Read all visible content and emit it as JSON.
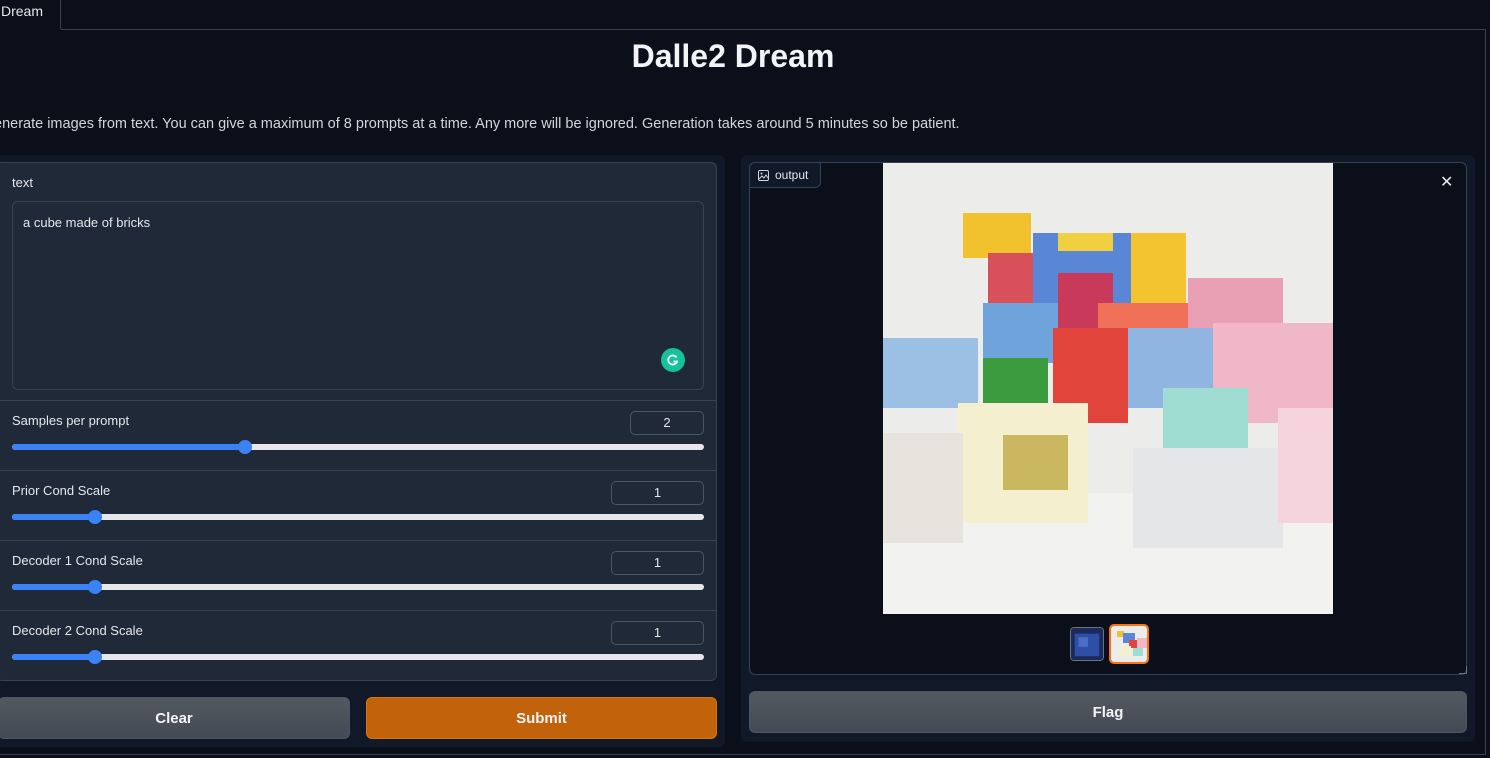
{
  "tab": {
    "label": "Dream"
  },
  "header": {
    "title": "Dalle2 Dream",
    "description": "enerate images from text. You can give a maximum of 8 prompts at a time. Any more will be ignored. Generation takes around 5 minutes so be patient."
  },
  "inputs": {
    "text_label": "text",
    "text_value": "a cube made of bricks",
    "sliders": [
      {
        "label": "Samples per prompt",
        "value": "2",
        "fraction": 0.337
      },
      {
        "label": "Prior Cond Scale",
        "value": "1",
        "fraction": 0.12
      },
      {
        "label": "Decoder 1 Cond Scale",
        "value": "1",
        "fraction": 0.12
      },
      {
        "label": "Decoder 2 Cond Scale",
        "value": "1",
        "fraction": 0.12
      }
    ]
  },
  "actions": {
    "clear": "Clear",
    "submit": "Submit",
    "flag": "Flag"
  },
  "output": {
    "label": "output",
    "selected_thumbnail": 2,
    "thumbnail_count": 2
  },
  "colors": {
    "accent": "#3b82f6",
    "submit": "#c2620a",
    "selected_border": "#f97316"
  }
}
